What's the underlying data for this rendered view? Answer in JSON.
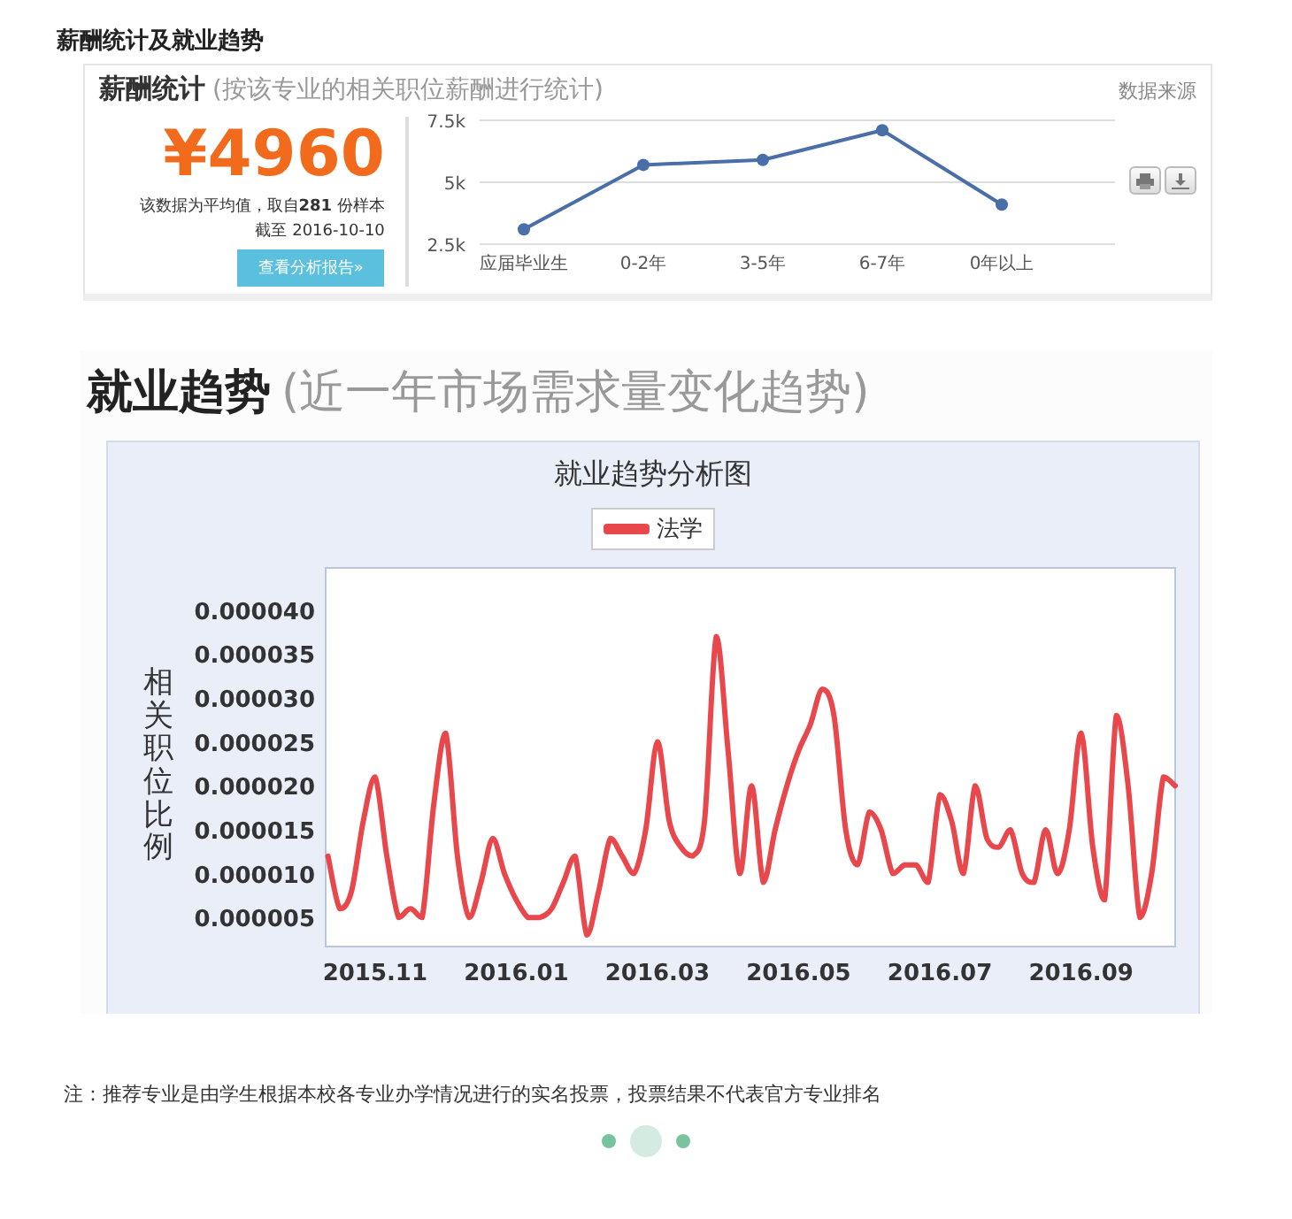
{
  "heading": "薪酬统计及就业趋势",
  "salary": {
    "title": "薪酬统计",
    "subtitle": "(按该专业的相关职位薪酬进行统计)",
    "source": "数据来源",
    "amount": "¥4960",
    "note": "该数据为平均值，取自**281** 份样本",
    "date_label": "截至",
    "date": "2016-10-10",
    "button": "查看分析报告»",
    "chart_data": {
      "type": "line",
      "categories": [
        "应届毕业生",
        "0-2年",
        "3-5年",
        "6-7年",
        "0年以上"
      ],
      "series": [
        {
          "color": "#4a6ea8",
          "marker": "circle",
          "values": [
            3100,
            5700,
            5900,
            7100,
            4100
          ]
        }
      ],
      "ylim": [
        2500,
        7500
      ],
      "yticks": [
        {
          "value": 2500,
          "label": "2.5k"
        },
        {
          "value": 5000,
          "label": "5k"
        },
        {
          "value": 7500,
          "label": "7.5k"
        }
      ]
    }
  },
  "trend": {
    "title": "就业趋势",
    "subtitle": "(近一年市场需求量变化趋势)",
    "chart_data": {
      "type": "line",
      "title": "就业趋势分析图",
      "ylabel": "相关职位比例",
      "ylim": [
        1.7e-06,
        4.48e-05
      ],
      "categories": [
        null,
        null,
        null,
        null,
        "2015.11",
        null,
        null,
        null,
        null,
        null,
        null,
        null,
        null,
        null,
        null,
        null,
        "2016.01",
        null,
        null,
        null,
        null,
        null,
        null,
        null,
        null,
        null,
        null,
        null,
        "2016.03",
        null,
        null,
        null,
        null,
        null,
        null,
        null,
        null,
        null,
        null,
        null,
        "2016.05",
        null,
        null,
        null,
        null,
        null,
        null,
        null,
        null,
        null,
        null,
        null,
        "2016.07",
        null,
        null,
        null,
        null,
        null,
        null,
        null,
        null,
        null,
        null,
        null,
        "2016.09",
        null,
        null,
        null,
        null,
        null,
        null,
        null,
        null
      ],
      "yticks": [
        {
          "value": 5e-06,
          "label": "0.000005"
        },
        {
          "value": 1e-05,
          "label": "0.000010"
        },
        {
          "value": 1.5e-05,
          "label": "0.000015"
        },
        {
          "value": 2e-05,
          "label": "0.000020"
        },
        {
          "value": 2.5e-05,
          "label": "0.000025"
        },
        {
          "value": 3e-05,
          "label": "0.000030"
        },
        {
          "value": 3.5e-05,
          "label": "0.000035"
        },
        {
          "value": 4e-05,
          "label": "0.000040"
        }
      ],
      "series": [
        {
          "name": "法学",
          "color": "#e8474c",
          "values": [
            1.2e-05,
            6e-06,
            8e-06,
            1.6e-05,
            2.1e-05,
            1.2e-05,
            5e-06,
            6e-06,
            5e-06,
            1.8e-05,
            2.6e-05,
            1.2e-05,
            5e-06,
            9e-06,
            1.4e-05,
            1e-05,
            7e-06,
            5e-06,
            5e-06,
            6e-06,
            9e-06,
            1.2e-05,
            3e-06,
            8e-06,
            1.4e-05,
            1.2e-05,
            1e-05,
            1.5e-05,
            2.5e-05,
            1.6e-05,
            1.3e-05,
            1.2e-05,
            1.6e-05,
            3.7e-05,
            2.4e-05,
            1e-05,
            2e-05,
            9e-06,
            1.5e-05,
            2e-05,
            2.4e-05,
            2.7e-05,
            3.1e-05,
            2.8e-05,
            1.5e-05,
            1.1e-05,
            1.7e-05,
            1.5e-05,
            1e-05,
            1.1e-05,
            1.1e-05,
            9e-06,
            1.9e-05,
            1.6e-05,
            1e-05,
            2e-05,
            1.4e-05,
            1.3e-05,
            1.5e-05,
            1e-05,
            9e-06,
            1.5e-05,
            1e-05,
            1.5e-05,
            2.6e-05,
            1.3e-05,
            7e-06,
            2.8e-05,
            2e-05,
            5e-06,
            1e-05,
            2.1e-05,
            2e-05
          ]
        }
      ]
    }
  },
  "footnote": "注：推荐专业是由学生根据本校各专业办学情况进行的实名投票，投票结果不代表官方专业排名",
  "pager": [
    {
      "selected": false
    },
    {
      "selected": true
    },
    {
      "selected": false
    }
  ]
}
